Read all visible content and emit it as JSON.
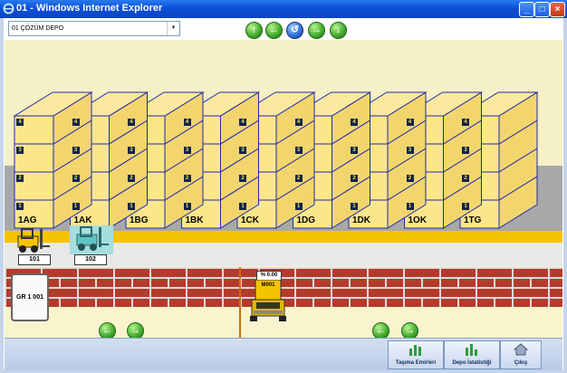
{
  "window": {
    "title": "01 - Windows Internet Explorer"
  },
  "toolbar": {
    "depot_select": "01 ÇÖZÜM DEPO"
  },
  "racks": [
    "1AG",
    "1AK",
    "1BG",
    "1BK",
    "1CK",
    "1DG",
    "1DK",
    "1OK",
    "1TG"
  ],
  "levels": [
    "1",
    "2",
    "3",
    "4"
  ],
  "forklifts": [
    {
      "label": "101",
      "color": "#f5c400"
    },
    {
      "label": "102",
      "color": "#5ec3c3"
    }
  ],
  "dock": {
    "gate_label": "GR 1 001",
    "truck_label": "M001",
    "truck_percent": "% 0.00"
  },
  "bottom": {
    "transport_orders": "Taşıma Emirleri",
    "depot_stats": "Depo İstatistiği",
    "exit": "Çıkış"
  },
  "colors": {
    "accent": "#0a4fd8",
    "rack_fill": "#fde68a",
    "rack_edge": "#1f2aa8",
    "floor": "#a8a8a8",
    "brick": "#b43b2c"
  }
}
